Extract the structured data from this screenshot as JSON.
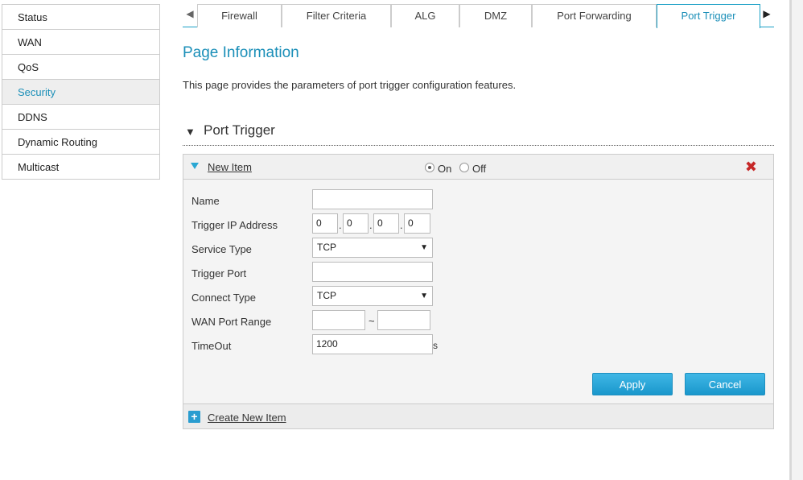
{
  "sidebar": {
    "items": [
      {
        "label": "Status"
      },
      {
        "label": "WAN"
      },
      {
        "label": "QoS"
      },
      {
        "label": "Security"
      },
      {
        "label": "DDNS"
      },
      {
        "label": "Dynamic Routing"
      },
      {
        "label": "Multicast"
      }
    ]
  },
  "tabs": [
    {
      "label": "Firewall"
    },
    {
      "label": "Filter Criteria"
    },
    {
      "label": "ALG"
    },
    {
      "label": "DMZ"
    },
    {
      "label": "Port Forwarding"
    },
    {
      "label": "Port Trigger"
    }
  ],
  "page": {
    "title": "Page Information",
    "description": "This page provides the parameters of port trigger configuration features."
  },
  "section": {
    "title": "Port Trigger"
  },
  "item": {
    "link": "New Item",
    "on_label": "On",
    "off_label": "Off",
    "state": "On",
    "close_glyph": "✖"
  },
  "form": {
    "name_label": "Name",
    "name_value": "",
    "trigger_ip_label": "Trigger IP Address",
    "trigger_ip": [
      "0",
      "0",
      "0",
      "0"
    ],
    "service_type_label": "Service Type",
    "service_type": "TCP",
    "trigger_port_label": "Trigger Port",
    "trigger_port": "",
    "connect_type_label": "Connect Type",
    "connect_type": "TCP",
    "wan_range_label": "WAN Port Range",
    "wan_range_start": "",
    "wan_range_sep": "~",
    "wan_range_end": "",
    "timeout_label": "TimeOut",
    "timeout_value": "1200",
    "timeout_unit": "s"
  },
  "buttons": {
    "apply": "Apply",
    "cancel": "Cancel"
  },
  "footer": {
    "create_link": "Create New Item",
    "plus_glyph": "+"
  },
  "glyphs": {
    "tab_left": "◀",
    "tab_right": "▶",
    "section_tri": "▼",
    "caret": "▼",
    "ip_dot": "."
  },
  "colors": {
    "accent": "#1b8fb8",
    "button": "#1a97cc",
    "delete": "#c62828"
  }
}
